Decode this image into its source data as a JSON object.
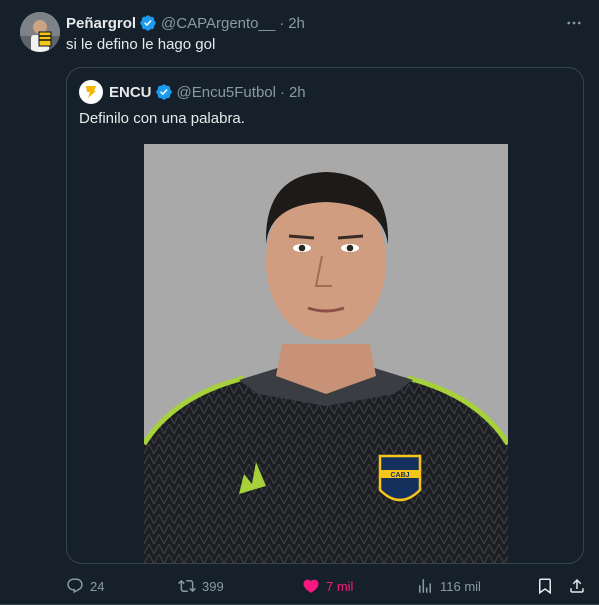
{
  "tweet": {
    "display_name": "Peñargrol",
    "handle": "@CAPArgento__",
    "separator": "·",
    "time": "2h",
    "text": "si le defino le hago gol"
  },
  "quote": {
    "display_name": "ENCU",
    "handle": "@Encu5Futbol",
    "separator": "·",
    "time": "2h",
    "text": "Definilo con una palabra.",
    "media_badge_text": "CABJ"
  },
  "actions": {
    "replies": "24",
    "retweets": "399",
    "likes": "7 mil",
    "views": "116 mil"
  },
  "colors": {
    "background": "#15202b",
    "verified": "#1d9bf0",
    "like": "#f91880",
    "secondary_text": "#8b98a5"
  },
  "icons": {
    "more": "more-horizontal-icon",
    "verified": "verified-badge-icon",
    "reply": "reply-icon",
    "retweet": "retweet-icon",
    "like": "heart-filled-icon",
    "views": "analytics-icon",
    "bookmark": "bookmark-icon",
    "share": "share-icon"
  }
}
